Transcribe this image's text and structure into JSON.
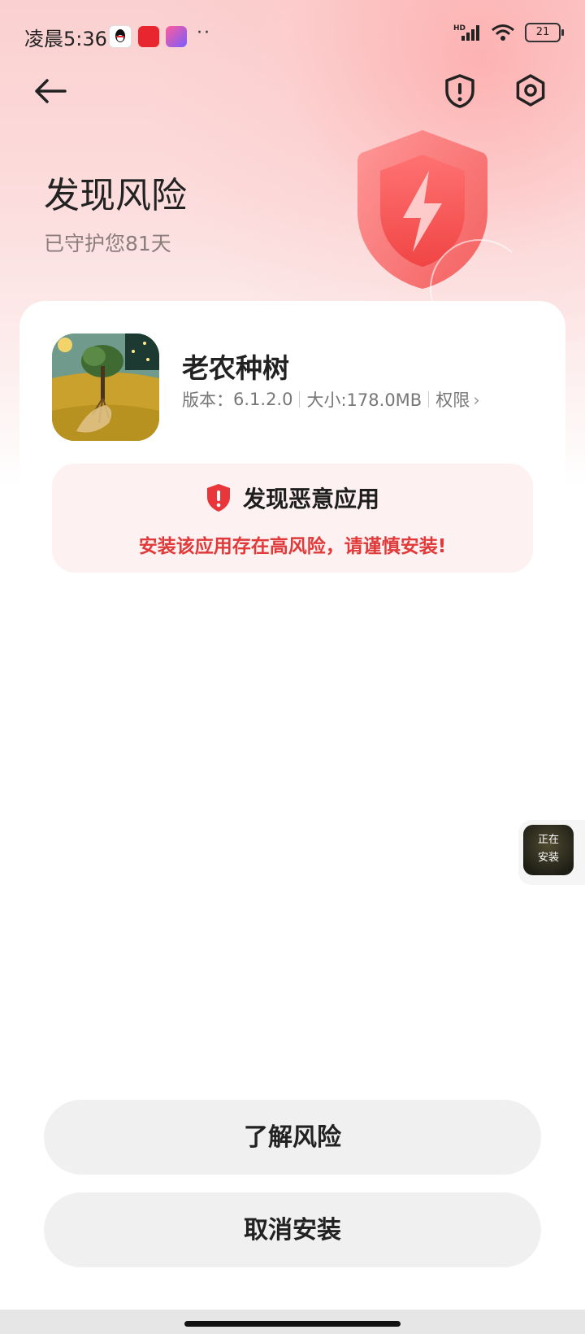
{
  "status_bar": {
    "time": "凌晨5:36",
    "dots": "··",
    "network": "HD",
    "battery": "21"
  },
  "header": {
    "title": "发现风险",
    "subtitle": "已守护您81天"
  },
  "app": {
    "name": "老农种树",
    "version_label": "版本：",
    "version": "6.1.2.0",
    "size_text": "大小:178.0MB",
    "permissions_label": "权限",
    "permissions_arrow": "›"
  },
  "warning": {
    "title": "发现恶意应用",
    "description": "安装该应用存在高风险，请谨慎安装!"
  },
  "floating": {
    "line1": "正在",
    "line2": "安装"
  },
  "actions": {
    "understand_risk": "了解风险",
    "cancel_install": "取消安装"
  },
  "colors": {
    "danger": "#e03a3a",
    "shield_red": "#f25555",
    "button_bg": "#f0f0f0"
  }
}
